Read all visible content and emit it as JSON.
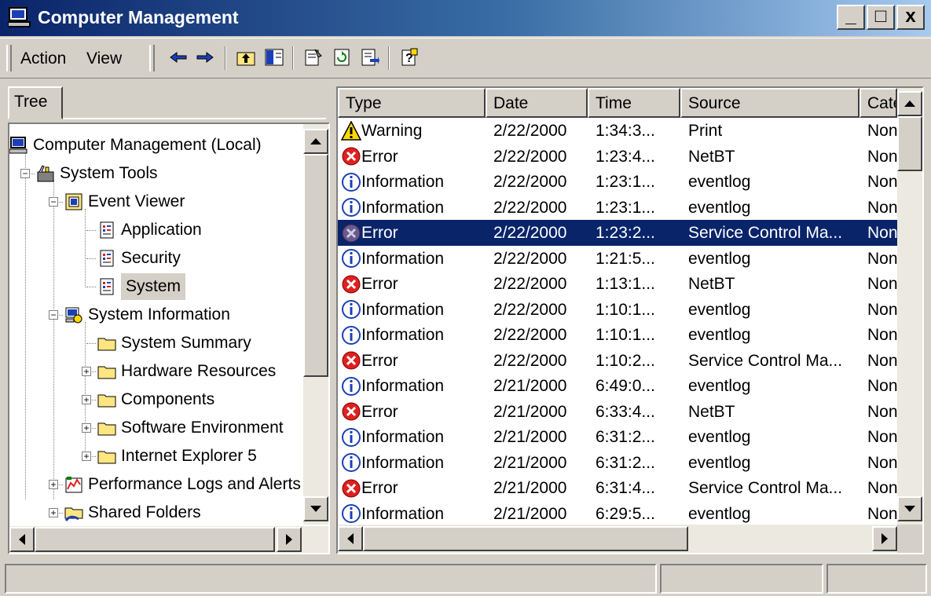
{
  "window": {
    "title": "Computer Management",
    "minimize_label": "_",
    "maximize_label": "□",
    "close_label": "x"
  },
  "toolbar": {
    "menu": [
      "Action",
      "View"
    ],
    "icons": [
      "back-arrow-icon",
      "forward-arrow-icon",
      "up-one-level-icon",
      "show-hide-tree-icon",
      "properties-icon",
      "refresh-icon",
      "export-list-icon",
      "help-icon"
    ]
  },
  "tree": {
    "tab_label": "Tree",
    "nodes": [
      {
        "label": "Computer Management (Local)",
        "icon": "computer-icon"
      },
      {
        "label": "System Tools",
        "icon": "toolbox-icon",
        "expander": "-"
      },
      {
        "label": "Event Viewer",
        "icon": "event-viewer-icon",
        "expander": "-"
      },
      {
        "label": "Application",
        "icon": "event-log-icon"
      },
      {
        "label": "Security",
        "icon": "event-log-icon"
      },
      {
        "label": "System",
        "icon": "event-log-icon",
        "selected": true
      },
      {
        "label": "System Information",
        "icon": "system-information-icon",
        "expander": "-"
      },
      {
        "label": "System Summary",
        "icon": "folder-icon"
      },
      {
        "label": "Hardware Resources",
        "icon": "folder-icon",
        "expander": "+"
      },
      {
        "label": "Components",
        "icon": "folder-icon",
        "expander": "+"
      },
      {
        "label": "Software Environment",
        "icon": "folder-icon",
        "expander": "+"
      },
      {
        "label": "Internet Explorer 5",
        "icon": "folder-icon",
        "expander": "+"
      },
      {
        "label": "Performance Logs and Alerts",
        "icon": "performance-icon",
        "expander": "+"
      },
      {
        "label": "Shared Folders",
        "icon": "shared-folder-icon",
        "expander": "+"
      }
    ]
  },
  "list": {
    "columns": [
      "Type",
      "Date",
      "Time",
      "Source",
      "Cate"
    ],
    "rows": [
      {
        "type": "Warning",
        "icon": "warning-icon",
        "date": "2/22/2000",
        "time": "1:34:3...",
        "source": "Print",
        "category": "None"
      },
      {
        "type": "Error",
        "icon": "error-icon",
        "date": "2/22/2000",
        "time": "1:23:4...",
        "source": "NetBT",
        "category": "None"
      },
      {
        "type": "Information",
        "icon": "information-icon",
        "date": "2/22/2000",
        "time": "1:23:1...",
        "source": "eventlog",
        "category": "None"
      },
      {
        "type": "Information",
        "icon": "information-icon",
        "date": "2/22/2000",
        "time": "1:23:1...",
        "source": "eventlog",
        "category": "None"
      },
      {
        "type": "Error",
        "icon": "error-icon",
        "date": "2/22/2000",
        "time": "1:23:2...",
        "source": "Service Control Ma...",
        "category": "None",
        "selected": true
      },
      {
        "type": "Information",
        "icon": "information-icon",
        "date": "2/22/2000",
        "time": "1:21:5...",
        "source": "eventlog",
        "category": "None"
      },
      {
        "type": "Error",
        "icon": "error-icon",
        "date": "2/22/2000",
        "time": "1:13:1...",
        "source": "NetBT",
        "category": "None"
      },
      {
        "type": "Information",
        "icon": "information-icon",
        "date": "2/22/2000",
        "time": "1:10:1...",
        "source": "eventlog",
        "category": "None"
      },
      {
        "type": "Information",
        "icon": "information-icon",
        "date": "2/22/2000",
        "time": "1:10:1...",
        "source": "eventlog",
        "category": "None"
      },
      {
        "type": "Error",
        "icon": "error-icon",
        "date": "2/22/2000",
        "time": "1:10:2...",
        "source": "Service Control Ma...",
        "category": "None"
      },
      {
        "type": "Information",
        "icon": "information-icon",
        "date": "2/21/2000",
        "time": "6:49:0...",
        "source": "eventlog",
        "category": "None"
      },
      {
        "type": "Error",
        "icon": "error-icon",
        "date": "2/21/2000",
        "time": "6:33:4...",
        "source": "NetBT",
        "category": "None"
      },
      {
        "type": "Information",
        "icon": "information-icon",
        "date": "2/21/2000",
        "time": "6:31:2...",
        "source": "eventlog",
        "category": "None"
      },
      {
        "type": "Information",
        "icon": "information-icon",
        "date": "2/21/2000",
        "time": "6:31:2...",
        "source": "eventlog",
        "category": "None"
      },
      {
        "type": "Error",
        "icon": "error-icon",
        "date": "2/21/2000",
        "time": "6:31:4...",
        "source": "Service Control Ma...",
        "category": "None"
      },
      {
        "type": "Information",
        "icon": "information-icon",
        "date": "2/21/2000",
        "time": "6:29:5...",
        "source": "eventlog",
        "category": "None"
      }
    ]
  },
  "colors": {
    "title_bar_start": "#0a246a",
    "title_bar_end": "#a6caf0",
    "selection": "#0a246a",
    "error": "#e02020",
    "warning": "#ffd800",
    "information": "#1c3fb8"
  }
}
